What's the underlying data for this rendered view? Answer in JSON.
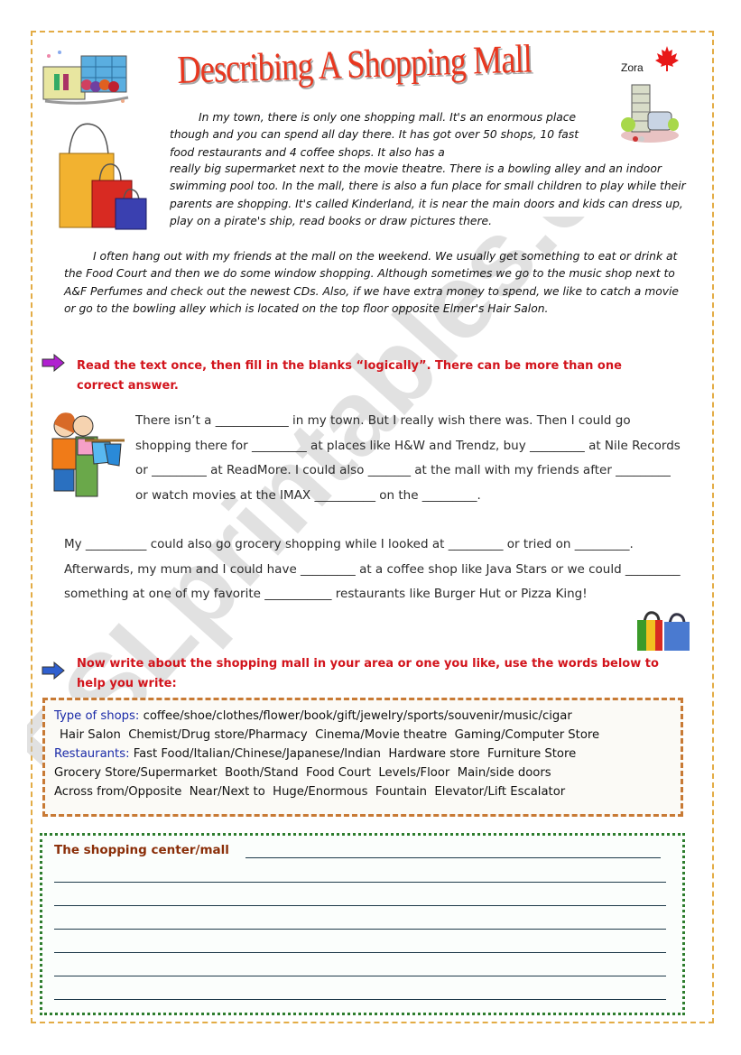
{
  "header": {
    "title": "Describing A Shopping Mall",
    "author": "Zora"
  },
  "reading": {
    "para1_lines_a": "In my town, there is only one shopping mall. It's an enormous place though and you can spend all day there. It has got over 50 shops, 10 fast food restaurants and 4 coffee shops. It also has a",
    "para1_lines_b": "really big supermarket next to the movie theatre. There is a bowling alley and an indoor swimming pool too. In the mall, there is also a fun place for small children to play while their parents are shopping. It's called Kinderland, it is near the main doors and kids can dress up, play on a pirate's ship, read books or draw pictures there.",
    "para2": "I often hang out with my friends at the mall on the weekend. We usually get something to eat or drink at the Food Court and then we do some window shopping. Although sometimes we go to the music shop next to A&F Perfumes and check out the newest CDs. Also, if we have extra money to spend, we like to catch a movie or go to the bowling alley which is located on the top floor opposite Elmer's Hair Salon."
  },
  "exercise1": {
    "instruction": "Read the text once, then fill in the blanks “logically”. There can be more than one correct answer.",
    "text_part1": "There isn’t a ____________ in my town. But I really wish there was. Then I could go shopping there for _________ at places like H&W and Trendz, buy _________ at Nile Records or _________ at ReadMore. I could also _______ at the mall with my friends after _________ or watch movies at the IMAX __________ on the _________.",
    "text_part2": "My __________ could also go grocery shopping while I looked at _________ or tried on _________. Afterwards, my mum and I could have _________ at a coffee shop like Java Stars or we could _________ something at one of my favorite ___________ restaurants like Burger Hut or Pizza King!"
  },
  "exercise2": {
    "instruction": "Now write about the shopping mall in your area or one you like, use the words below to help you write:",
    "word_box": {
      "shops_label": "Type of shops:",
      "shops_list": " coffee/shoe/clothes/flower/book/gift/jewelry/sports/souvenir/music/cigar",
      "line2": "Hair Salon  Chemist/Drug store/Pharmacy  Cinema/Movie theatre  Gaming/Computer Store",
      "restaurants_label": "Restaurants:",
      "restaurants_list": " Fast Food/Italian/Chinese/Japanese/Indian  Hardware store  Furniture Store",
      "line4": "Grocery Store/Supermarket  Booth/Stand  Food Court  Levels/Floor  Main/side doors",
      "line5": "Across from/Opposite  Near/Next to  Huge/Enormous  Fountain  Elevator/Lift Escalator"
    },
    "writing_prompt": "The shopping center/mall",
    "writing_lines": 6
  },
  "watermark": "ESLprintables.com",
  "colors": {
    "title_red": "#e8371f",
    "instruction_red": "#d2141c",
    "label_blue": "#1a2aa8",
    "frame_orange": "#e3ac45",
    "writebox_green": "#2e7d2e",
    "arrow1_purple": "#b020d0",
    "arrow2_blue": "#2f5fcf"
  }
}
